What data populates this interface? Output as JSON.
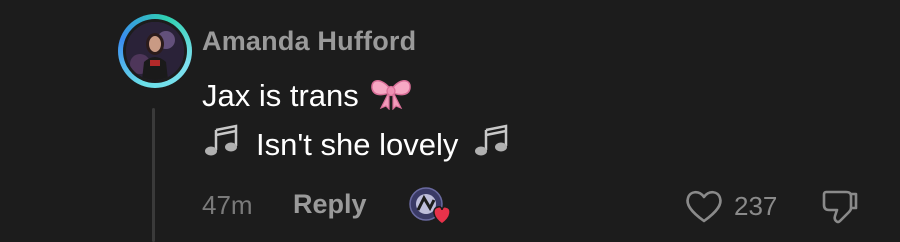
{
  "comment": {
    "author": "Amanda Hufford",
    "line1_text": "Jax is trans",
    "line1_emoji": "bow-emoji",
    "line2_text": "Isn't she lovely",
    "line2_emoji_left": "music-notes-emoji",
    "line2_emoji_right": "music-notes-emoji",
    "time": "47m",
    "reply_label": "Reply",
    "like_count": "237",
    "liked_by_creator": true
  },
  "colors": {
    "background": "#1c1c1c",
    "author": "#9a9a9a",
    "body": "#ffffff",
    "meta": "#7a7a7a",
    "heart_badge": "#e8324a",
    "ring_accent": "#3a8cf0"
  },
  "icons": {
    "like": "heart-outline-icon",
    "dislike": "thumbs-down-outline-icon",
    "creator_heart": "heart-filled-icon"
  }
}
